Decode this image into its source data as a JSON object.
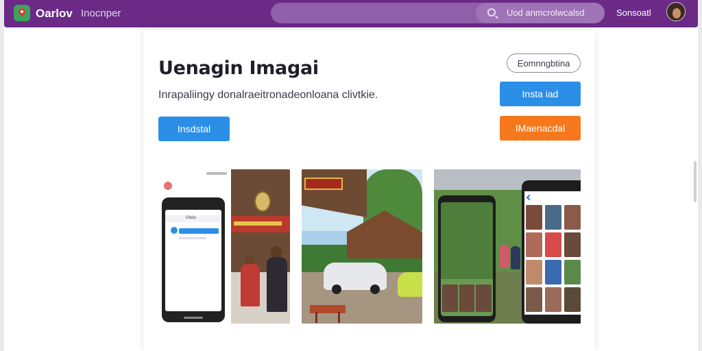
{
  "header": {
    "brand": "Oarlov",
    "nav_link": "Inocnper",
    "search_text": "Uod anmcrolwcalsd",
    "account": "Sonsoatl"
  },
  "hero": {
    "title": "Uenagin Imagai",
    "description": "Inrapaliingy donalraeitronadeonloana clivtkie.",
    "outline_button": "Eomnngbtina",
    "primary_left_button": "Insdstal",
    "primary_right_button": "Insta iad",
    "orange_button": "IMaenacdal"
  },
  "screenshot1": {
    "phone_header": "Gbda"
  },
  "colors": {
    "topbar": "#6a2a86",
    "blue": "#2b8fe8",
    "orange": "#f5791c"
  },
  "icons": [
    "logo-pin-icon",
    "search-icon",
    "user-avatar"
  ]
}
